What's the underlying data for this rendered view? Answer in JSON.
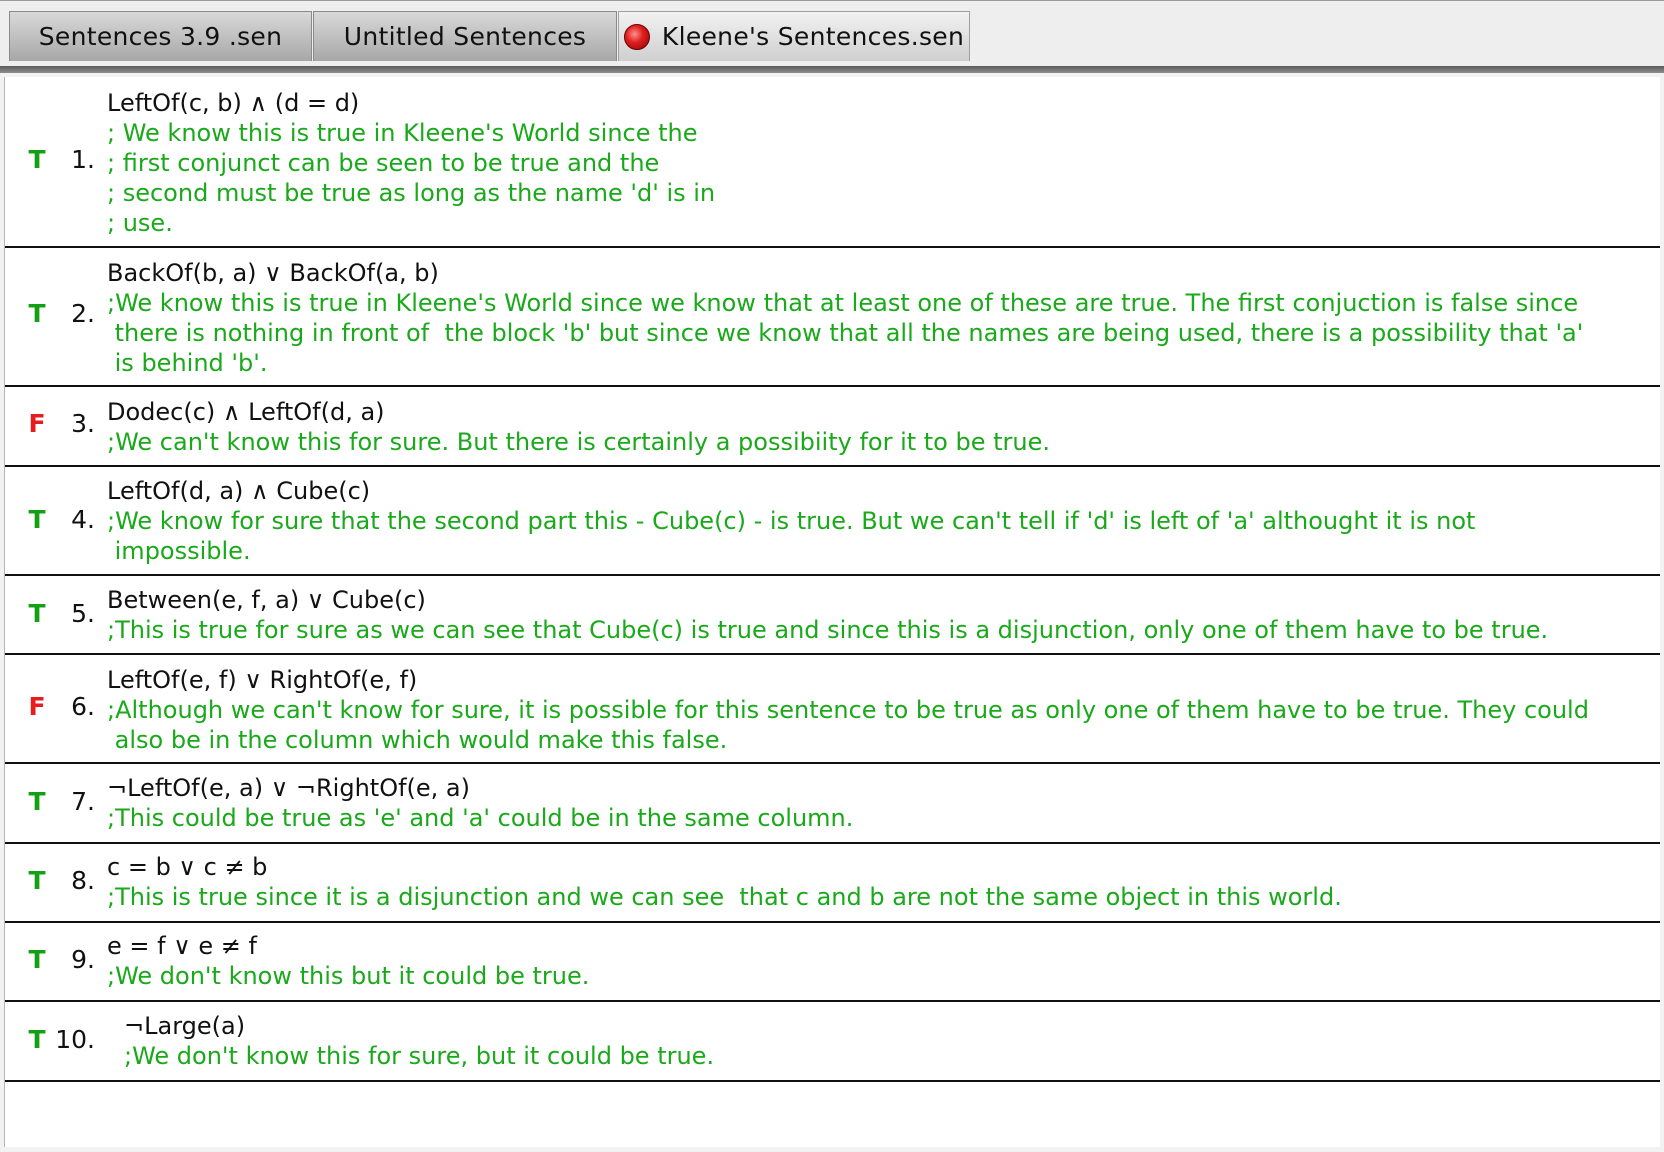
{
  "tabs": [
    {
      "label": "Sentences 3.9 .sen"
    },
    {
      "label": "Untitled Sentences"
    },
    {
      "label": "Kleene's Sentences.sen",
      "icon": "red-sphere-icon",
      "active": true
    }
  ],
  "colors": {
    "true_value": "#14a014",
    "false_value": "#e81c1c",
    "comment": "#1aa91a",
    "formula": "#111111"
  },
  "sentences": [
    {
      "value": "T",
      "number": "1.",
      "formula": "LeftOf(c, b) ∧ (d = d)",
      "comment_lines": [
        "; We know this is true in Kleene's World since the",
        "; first conjunct can be seen to be true and the",
        "; second must be true as long as the name 'd' is in",
        "; use."
      ]
    },
    {
      "value": "T",
      "number": "2.",
      "formula": "BackOf(b, a) ∨ BackOf(a, b)",
      "comment_lines": [
        ";We know this is true in Kleene's World since we know that at least one of these are true. The first conjuction is false since",
        " there is nothing in front of  the block 'b' but since we know that all the names are being used, there is a possibility that 'a'",
        " is behind 'b'."
      ]
    },
    {
      "value": "F",
      "number": "3.",
      "formula": "Dodec(c) ∧ LeftOf(d, a)",
      "comment_lines": [
        ";We can't know this for sure. But there is certainly a possibiity for it to be true."
      ]
    },
    {
      "value": "T",
      "number": "4.",
      "formula": "LeftOf(d, a) ∧ Cube(c)",
      "comment_lines": [
        ";We know for sure that the second part this - Cube(c) - is true. But we can't tell if 'd' is left of 'a' althought it is not",
        " impossible."
      ]
    },
    {
      "value": "T",
      "number": "5.",
      "formula": "Between(e, f, a) ∨ Cube(c)",
      "comment_lines": [
        ";This is true for sure as we can see that Cube(c) is true and since this is a disjunction, only one of them have to be true."
      ]
    },
    {
      "value": "F",
      "number": "6.",
      "formula": "LeftOf(e, f) ∨ RightOf(e, f)",
      "comment_lines": [
        ";Although we can't know for sure, it is possible for this sentence to be true as only one of them have to be true. They could",
        " also be in the column which would make this false."
      ]
    },
    {
      "value": "T",
      "number": "7.",
      "formula": "¬LeftOf(e, a) ∨ ¬RightOf(e, a)",
      "comment_lines": [
        ";This could be true as 'e' and 'a' could be in the same column."
      ]
    },
    {
      "value": "T",
      "number": "8.",
      "formula": "c = b ∨ c ≠ b",
      "comment_lines": [
        ";This is true since it is a disjunction and we can see  that c and b are not the same object in this world."
      ]
    },
    {
      "value": "T",
      "number": "9.",
      "formula": "e = f ∨ e ≠ f",
      "comment_lines": [
        ";We don't know this but it could be true."
      ]
    },
    {
      "value": "T",
      "number": "10.",
      "formula": "¬Large(a)",
      "comment_lines": [
        ";We don't know this for sure, but it could be true."
      ]
    }
  ]
}
